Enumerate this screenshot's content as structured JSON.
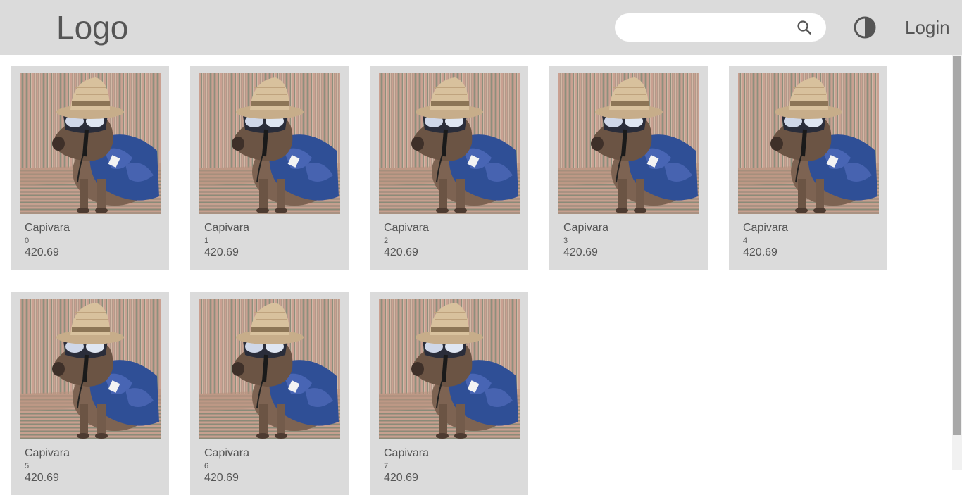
{
  "header": {
    "logo": "Logo",
    "search_value": "",
    "search_icon": "search-icon",
    "theme_icon": "contrast-icon",
    "login_label": "Login"
  },
  "products": [
    {
      "name": "Capivara",
      "id": "0",
      "price": "420.69"
    },
    {
      "name": "Capivara",
      "id": "1",
      "price": "420.69"
    },
    {
      "name": "Capivara",
      "id": "2",
      "price": "420.69"
    },
    {
      "name": "Capivara",
      "id": "3",
      "price": "420.69"
    },
    {
      "name": "Capivara",
      "id": "4",
      "price": "420.69"
    },
    {
      "name": "Capivara",
      "id": "5",
      "price": "420.69"
    },
    {
      "name": "Capivara",
      "id": "6",
      "price": "420.69"
    },
    {
      "name": "Capivara",
      "id": "7",
      "price": "420.69"
    }
  ],
  "colors": {
    "header_bg": "#dbdbdb",
    "card_bg": "#dbdbdb",
    "text": "#555555"
  }
}
